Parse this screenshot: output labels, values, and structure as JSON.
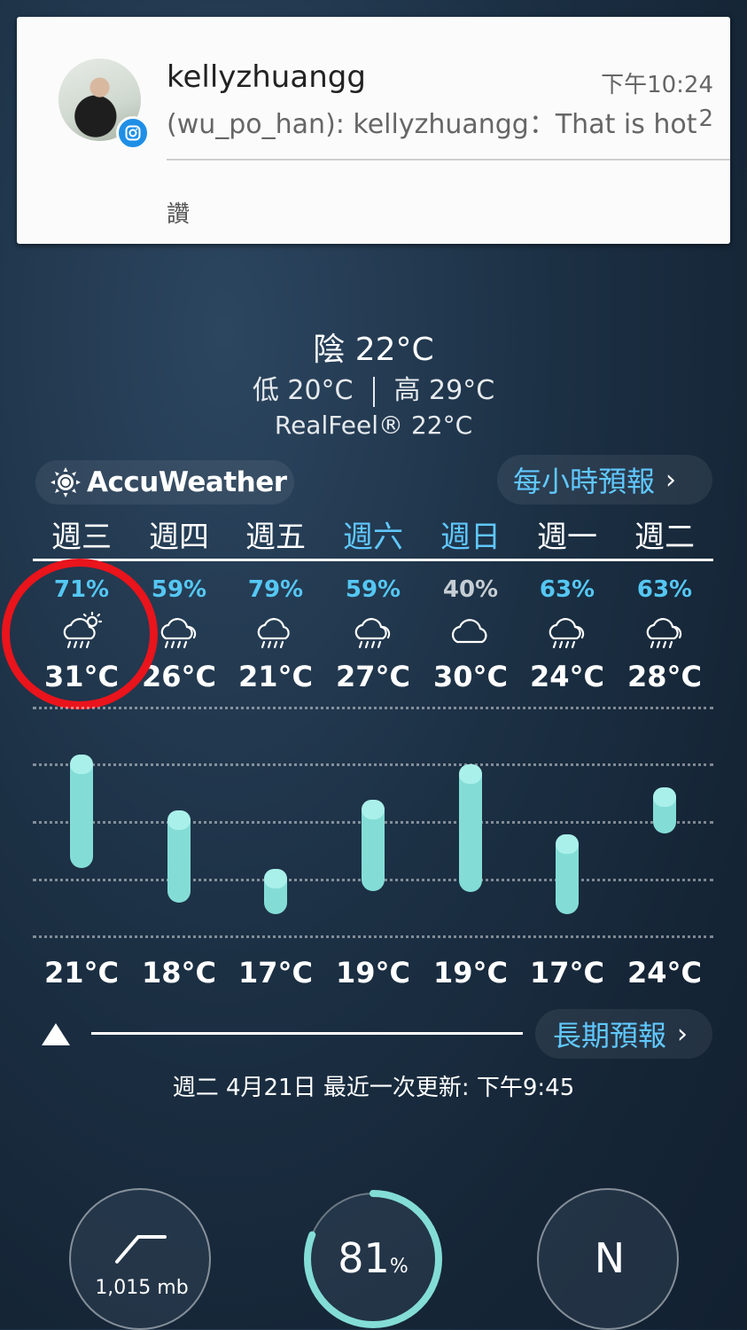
{
  "notification": {
    "title": "kellyzhuangg",
    "time": "下午10:24",
    "message": "(wu_po_han): kellyzhuangg：That is hot..",
    "count": "2",
    "action": "讚",
    "app_icon": "instagram-icon"
  },
  "current": {
    "condition": "陰 22°C",
    "low": "低 20°C",
    "high": "高 29°C",
    "realfeel": "RealFeel® 22°C"
  },
  "brand": {
    "name": "AccuWeather",
    "icon": "sun-icon"
  },
  "hourly_button": "每小時預報",
  "days": [
    {
      "label": "週三",
      "precip": "71%",
      "high": "31°C",
      "low": "21°C",
      "icon": "cloud-sun-rain-icon"
    },
    {
      "label": "週四",
      "precip": "59%",
      "high": "26°C",
      "low": "18°C",
      "icon": "cloud-rain-icon"
    },
    {
      "label": "週五",
      "precip": "79%",
      "high": "21°C",
      "low": "17°C",
      "icon": "cloud-rain-icon"
    },
    {
      "label": "週六",
      "precip": "59%",
      "high": "27°C",
      "low": "19°C",
      "icon": "cloud-rain-icon"
    },
    {
      "label": "週日",
      "precip": "40%",
      "high": "30°C",
      "low": "19°C",
      "icon": "cloud-icon"
    },
    {
      "label": "週一",
      "precip": "63%",
      "high": "24°C",
      "low": "17°C",
      "icon": "cloud-rain-icon"
    },
    {
      "label": "週二",
      "precip": "63%",
      "high": "28°C",
      "low": "24°C",
      "icon": "cloud-rain-icon"
    }
  ],
  "longterm_button": "長期預報",
  "updated": "週二 4月21日 最近一次更新: 下午9:45",
  "gauges": {
    "pressure": "1,015 mb",
    "humidity_value": "81",
    "humidity_unit": "%",
    "humidity_fraction": 0.81,
    "wind_direction": "N"
  },
  "colors": {
    "accent": "#60c8ff",
    "bar": "#83ddd6",
    "annotation": "#e9141c"
  }
}
